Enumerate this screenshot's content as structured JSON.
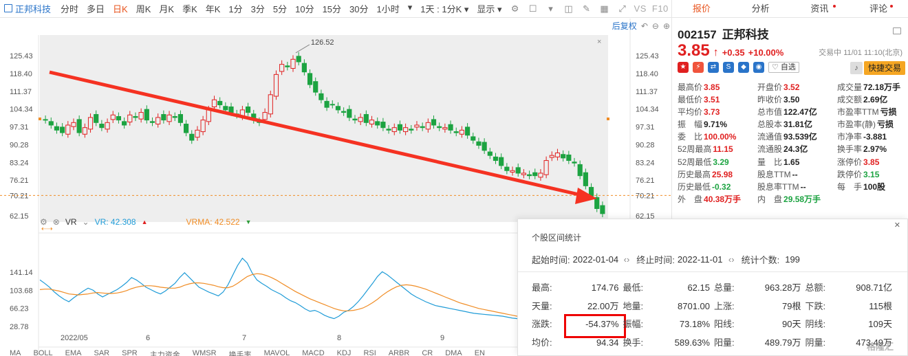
{
  "toolbar": {
    "stock_name": "正邦科技",
    "periods": [
      "分时",
      "多日",
      "日K",
      "周K",
      "月K",
      "季K",
      "年K",
      "1分",
      "3分",
      "5分",
      "10分",
      "15分",
      "30分",
      "1小时"
    ],
    "active_period": "日K",
    "adjust": "1天 : 1分K",
    "display": "显示",
    "vs": "VS",
    "f10": "F10"
  },
  "chart": {
    "restore_label": "后复权",
    "y_ticks": [
      "125.43",
      "118.40",
      "111.37",
      "104.34",
      "97.31",
      "90.28",
      "83.24",
      "76.21",
      "70.21",
      "62.15"
    ],
    "peak_label": "126.52",
    "x_labels": [
      "2022/05",
      "6",
      "7",
      "8",
      "9"
    ],
    "vr_ticks": [
      "141.14",
      "103.68",
      "66.23",
      "28.78"
    ],
    "indicator": {
      "name": "VR",
      "vr_label": "VR: 42.308",
      "vrma_label": "VRMA: 42.522",
      "vr_color": "#1e9bd7",
      "vrma_color": "#f08c24"
    },
    "bottom_tabs": [
      "MA",
      "BOLL",
      "EMA",
      "SAR",
      "SPR",
      "主力资金",
      "WMSR",
      "换手率",
      "MAVOL",
      "MACD",
      "KDJ",
      "RSI",
      "ARBR",
      "CR",
      "DMA",
      "EN"
    ],
    "up_color": "#e02020",
    "down_color": "#1ca341"
  },
  "chart_data": {
    "type": "candlestick",
    "y_axis": [
      62.15,
      125.43
    ],
    "x_labels": [
      "2022/05",
      "6",
      "7",
      "8",
      "9"
    ],
    "closes": [
      100,
      98,
      96,
      95,
      98,
      99,
      95,
      97,
      101,
      99,
      97,
      99,
      102,
      100,
      98,
      102,
      101,
      103,
      100,
      99,
      101,
      100,
      102,
      101,
      99,
      95,
      92,
      96,
      100,
      104,
      108,
      106,
      104,
      103,
      102,
      104,
      103,
      100,
      99,
      103,
      110,
      118,
      122,
      121,
      124,
      123,
      119,
      114,
      111,
      108,
      105,
      106,
      104,
      103,
      101,
      100,
      101,
      99,
      100,
      98,
      97,
      96,
      97,
      96,
      97,
      96,
      98,
      97,
      99,
      98,
      97,
      97,
      96,
      95,
      96,
      94,
      92,
      90,
      88,
      86,
      84,
      82,
      80,
      80,
      79,
      79,
      78,
      78,
      79,
      84,
      86,
      87,
      85,
      84,
      83,
      78,
      74,
      70,
      65,
      63
    ],
    "vr": [
      125,
      118,
      110,
      100,
      92,
      85,
      80,
      88,
      95,
      102,
      108,
      104,
      96,
      90,
      95,
      100,
      105,
      112,
      120,
      130,
      125,
      118,
      110,
      105,
      100,
      96,
      102,
      110,
      118,
      130,
      140,
      130,
      120,
      110,
      105,
      100,
      96,
      92,
      100,
      115,
      135,
      155,
      170,
      160,
      140,
      125,
      118,
      112,
      105,
      100,
      95,
      88,
      82,
      78,
      72,
      65,
      60,
      62,
      58,
      52,
      48,
      45,
      50,
      58,
      62,
      70,
      80,
      92,
      105,
      118,
      132,
      142,
      136,
      128,
      120,
      112,
      104,
      96,
      90,
      85,
      80,
      76,
      72,
      70,
      68,
      66,
      64,
      62,
      60,
      58,
      56,
      55,
      54,
      53,
      52,
      51,
      50,
      48,
      46,
      45
    ],
    "vrma": [
      105,
      106,
      106,
      104,
      102,
      99,
      96,
      95,
      94,
      95,
      96,
      98,
      99,
      98,
      97,
      97,
      98,
      100,
      103,
      107,
      110,
      112,
      113,
      113,
      112,
      110,
      109,
      108,
      108,
      110,
      114,
      117,
      119,
      119,
      118,
      116,
      114,
      111,
      109,
      109,
      112,
      118,
      125,
      132,
      136,
      138,
      137,
      134,
      130,
      125,
      119,
      113,
      107,
      101,
      96,
      91,
      86,
      82,
      78,
      74,
      70,
      66,
      63,
      61,
      61,
      62,
      64,
      67,
      72,
      78,
      85,
      93,
      100,
      106,
      111,
      114,
      115,
      114,
      112,
      109,
      106,
      102,
      98,
      94,
      90,
      86,
      82,
      78,
      75,
      72,
      69,
      66,
      64,
      62,
      60,
      58,
      56,
      54,
      52,
      50
    ]
  },
  "panel": {
    "tabs": [
      "报价",
      "分析",
      "资讯",
      "评论"
    ],
    "active_tab": "报价",
    "code": "002157",
    "name": "正邦科技",
    "price": "3.85",
    "change": "+0.35",
    "change_pct": "+10.00%",
    "trade_time": "交易中 11/01 11:10(北京)",
    "watch_label": "自选",
    "fast_trade": "快捷交易",
    "icons": [
      {
        "name": "china-flag-icon",
        "color": "#e02020",
        "glyph": "★"
      },
      {
        "name": "margin-icon",
        "color": "#f0543c",
        "glyph": "⚡"
      },
      {
        "name": "connect-icon",
        "color": "#2a74c9",
        "glyph": "⇄"
      },
      {
        "name": "s-icon",
        "color": "#2a74c9",
        "glyph": "S"
      },
      {
        "name": "tag-icon",
        "color": "#2a74c9",
        "glyph": "◆"
      },
      {
        "name": "bubble-icon",
        "color": "#2a74c9",
        "glyph": "◉"
      }
    ],
    "quote": [
      [
        {
          "l": "最高价",
          "v": "3.85",
          "c": "red"
        },
        {
          "l": "开盘价",
          "v": "3.52",
          "c": "red"
        },
        {
          "l": "成交量",
          "v": "72.18万手",
          "c": "blk"
        }
      ],
      [
        {
          "l": "最低价",
          "v": "3.51",
          "c": "red"
        },
        {
          "l": "昨收价",
          "v": "3.50",
          "c": "blk"
        },
        {
          "l": "成交额",
          "v": "2.69亿",
          "c": "blk"
        }
      ],
      [
        {
          "l": "平均价",
          "v": "3.73",
          "c": "red"
        },
        {
          "l": "总市值",
          "v": "122.47亿",
          "c": "blk"
        },
        {
          "l": "市盈率TTM",
          "v": "亏损",
          "c": "blk"
        }
      ],
      [
        {
          "l": "振　幅",
          "v": "9.71%",
          "c": "blk"
        },
        {
          "l": "总股本",
          "v": "31.81亿",
          "c": "blk"
        },
        {
          "l": "市盈率(静)",
          "v": "亏损",
          "c": "blk"
        }
      ],
      [
        {
          "l": "委　比",
          "v": "100.00%",
          "c": "red"
        },
        {
          "l": "流通值",
          "v": "93.539亿",
          "c": "blk"
        },
        {
          "l": "市净率",
          "v": "-3.881",
          "c": "blk"
        }
      ],
      [
        {
          "l": "52周最高",
          "v": "11.15",
          "c": "red"
        },
        {
          "l": "流通股",
          "v": "24.3亿",
          "c": "blk"
        },
        {
          "l": "换手率",
          "v": "2.97%",
          "c": "blk"
        }
      ],
      [
        {
          "l": "52周最低",
          "v": "3.29",
          "c": "green"
        },
        {
          "l": "量　比",
          "v": "1.65",
          "c": "blk"
        },
        {
          "l": "涨停价",
          "v": "3.85",
          "c": "red"
        }
      ],
      [
        {
          "l": "历史最高",
          "v": "25.98",
          "c": "red"
        },
        {
          "l": "股息TTM",
          "v": "--",
          "c": "blk"
        },
        {
          "l": "跌停价",
          "v": "3.15",
          "c": "green"
        }
      ],
      [
        {
          "l": "历史最低",
          "v": "-0.32",
          "c": "green"
        },
        {
          "l": "股息率TTM",
          "v": "--",
          "c": "blk"
        },
        {
          "l": "每　手",
          "v": "100股",
          "c": "blk"
        }
      ],
      [
        {
          "l": "外　盘",
          "v": "40.38万手",
          "c": "red"
        },
        {
          "l": "内　盘",
          "v": "29.58万手",
          "c": "green"
        },
        {
          "l": "",
          "v": "",
          "c": "blk"
        }
      ]
    ]
  },
  "popup": {
    "title": "个股区间统计",
    "start_label": "起始时间:",
    "start_date": "2022-01-04",
    "end_label": "终止时间:",
    "end_date": "2022-11-01",
    "count_label": "统计个数:",
    "count": "199",
    "rows": [
      [
        {
          "l": "最高:",
          "v": "174.76",
          "c": "red"
        },
        {
          "l": "最低:",
          "v": "62.15",
          "c": "green"
        },
        {
          "l": "总量:",
          "v": "963.28万",
          "c": "blk"
        },
        {
          "l": "总额:",
          "v": "908.71亿",
          "c": "blk"
        }
      ],
      [
        {
          "l": "天量:",
          "v": "22.00万",
          "c": "blk"
        },
        {
          "l": "地量:",
          "v": "8701.00",
          "c": "blk"
        },
        {
          "l": "上涨:",
          "v": "79根",
          "c": "red"
        },
        {
          "l": "下跌:",
          "v": "115根",
          "c": "green"
        }
      ],
      [
        {
          "l": "涨跌:",
          "v": "-54.37%",
          "c": "green"
        },
        {
          "l": "振幅:",
          "v": "73.18%",
          "c": "blk"
        },
        {
          "l": "阳线:",
          "v": "90天",
          "c": "red"
        },
        {
          "l": "阴线:",
          "v": "109天",
          "c": "green"
        }
      ],
      [
        {
          "l": "均价:",
          "v": "94.34",
          "c": "green"
        },
        {
          "l": "换手:",
          "v": "589.63%",
          "c": "blk"
        },
        {
          "l": "阳量:",
          "v": "489.79万",
          "c": "red"
        },
        {
          "l": "阴量:",
          "v": "473.49万",
          "c": "green"
        }
      ]
    ],
    "watermark": "格隆汇"
  }
}
